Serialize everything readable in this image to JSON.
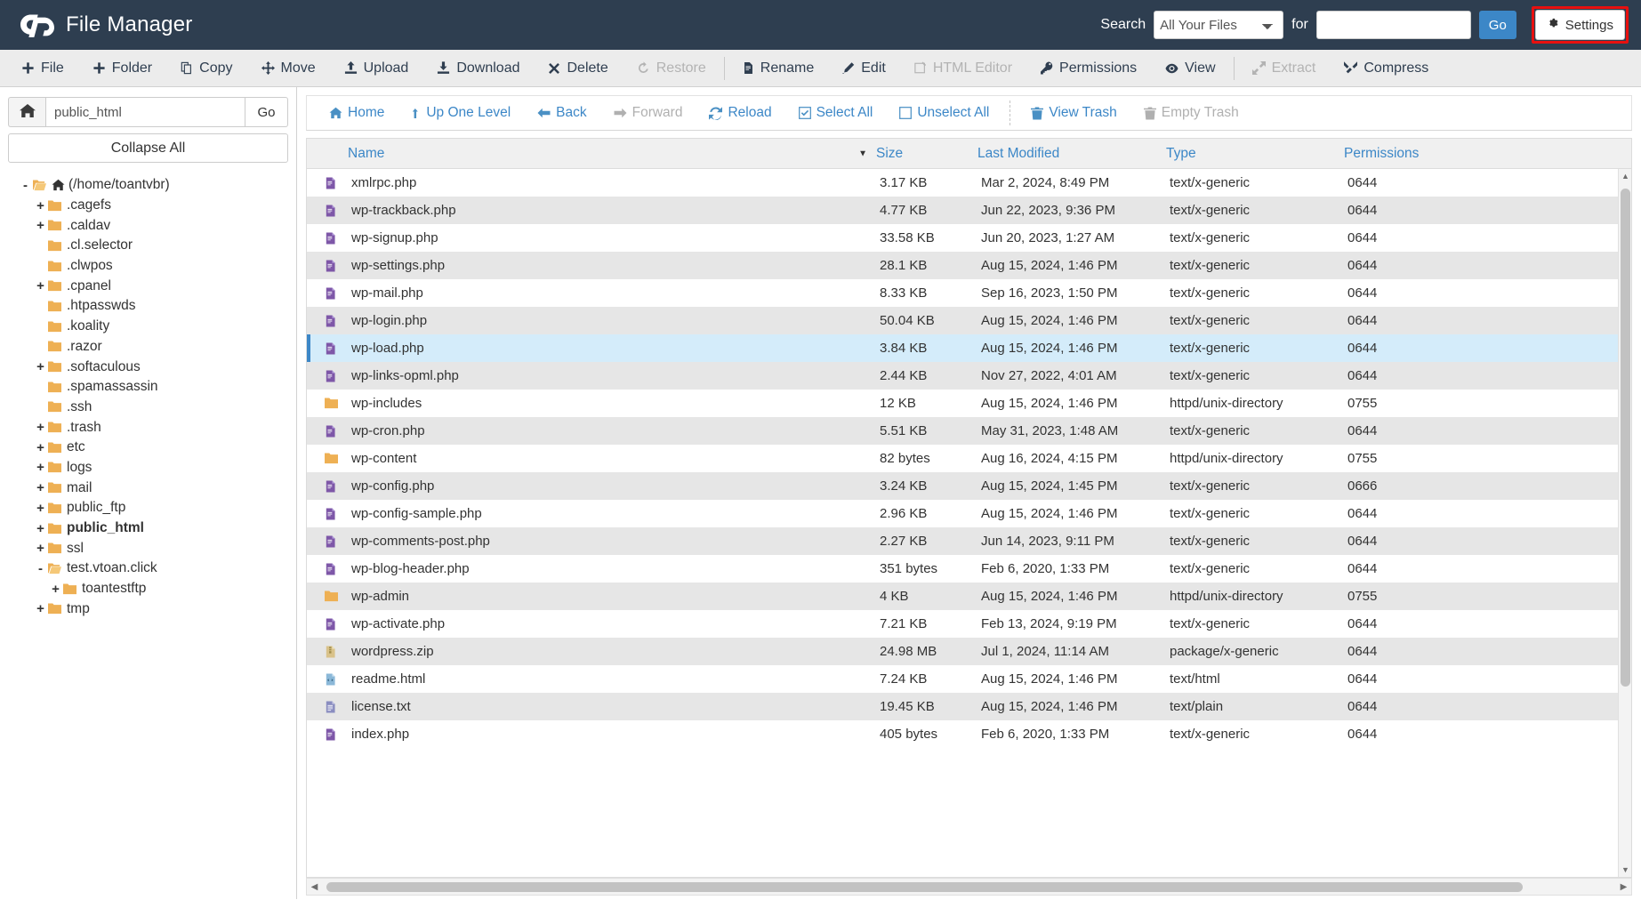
{
  "header": {
    "app_title": "File Manager",
    "logo_icon": "cpanel-logo-icon",
    "search_label": "Search",
    "search_scope_selected": "All Your Files",
    "search_scope_options": [
      "All Your Files"
    ],
    "for_label": "for",
    "search_value": "",
    "search_placeholder": "",
    "go_label": "Go",
    "settings_label": "Settings",
    "settings_icon": "gear-icon",
    "settings_highlight_color": "#e8100f",
    "bg_color": "#2e3e50"
  },
  "toolbar": {
    "items": [
      {
        "label": "File",
        "icon": "plus-icon",
        "disabled": false
      },
      {
        "label": "Folder",
        "icon": "plus-icon",
        "disabled": false
      },
      {
        "label": "Copy",
        "icon": "copy-icon",
        "disabled": false
      },
      {
        "label": "Move",
        "icon": "move-arrows-icon",
        "disabled": false
      },
      {
        "label": "Upload",
        "icon": "upload-icon",
        "disabled": false
      },
      {
        "label": "Download",
        "icon": "download-icon",
        "disabled": false
      },
      {
        "label": "Delete",
        "icon": "x-icon",
        "disabled": false
      },
      {
        "label": "Restore",
        "icon": "restore-icon",
        "disabled": true
      },
      {
        "separator": true
      },
      {
        "label": "Rename",
        "icon": "file-icon",
        "disabled": false
      },
      {
        "label": "Edit",
        "icon": "pencil-icon",
        "disabled": false
      },
      {
        "label": "HTML Editor",
        "icon": "html-editor-icon",
        "disabled": true
      },
      {
        "label": "Permissions",
        "icon": "key-icon",
        "disabled": false
      },
      {
        "label": "View",
        "icon": "eye-icon",
        "disabled": false
      },
      {
        "separator": true
      },
      {
        "label": "Extract",
        "icon": "extract-icon",
        "disabled": true
      },
      {
        "label": "Compress",
        "icon": "compress-icon",
        "disabled": false
      }
    ]
  },
  "sidebar": {
    "home_icon": "home-icon",
    "path_value": "public_html",
    "go_label": "Go",
    "collapse_all_label": "Collapse All",
    "tree": [
      {
        "toggle": "-",
        "label": "(/home/toantvbr)",
        "depth": 0,
        "open": true,
        "home": true,
        "bold": false
      },
      {
        "toggle": "+",
        "label": ".cagefs",
        "depth": 1,
        "open": false,
        "home": false,
        "bold": false
      },
      {
        "toggle": "+",
        "label": ".caldav",
        "depth": 1,
        "open": false,
        "home": false,
        "bold": false
      },
      {
        "toggle": "",
        "label": ".cl.selector",
        "depth": 1,
        "open": false,
        "home": false,
        "bold": false
      },
      {
        "toggle": "",
        "label": ".clwpos",
        "depth": 1,
        "open": false,
        "home": false,
        "bold": false
      },
      {
        "toggle": "+",
        "label": ".cpanel",
        "depth": 1,
        "open": false,
        "home": false,
        "bold": false
      },
      {
        "toggle": "",
        "label": ".htpasswds",
        "depth": 1,
        "open": false,
        "home": false,
        "bold": false
      },
      {
        "toggle": "",
        "label": ".koality",
        "depth": 1,
        "open": false,
        "home": false,
        "bold": false
      },
      {
        "toggle": "",
        "label": ".razor",
        "depth": 1,
        "open": false,
        "home": false,
        "bold": false
      },
      {
        "toggle": "+",
        "label": ".softaculous",
        "depth": 1,
        "open": false,
        "home": false,
        "bold": false
      },
      {
        "toggle": "",
        "label": ".spamassassin",
        "depth": 1,
        "open": false,
        "home": false,
        "bold": false
      },
      {
        "toggle": "",
        "label": ".ssh",
        "depth": 1,
        "open": false,
        "home": false,
        "bold": false
      },
      {
        "toggle": "+",
        "label": ".trash",
        "depth": 1,
        "open": false,
        "home": false,
        "bold": false
      },
      {
        "toggle": "+",
        "label": "etc",
        "depth": 1,
        "open": false,
        "home": false,
        "bold": false
      },
      {
        "toggle": "+",
        "label": "logs",
        "depth": 1,
        "open": false,
        "home": false,
        "bold": false
      },
      {
        "toggle": "+",
        "label": "mail",
        "depth": 1,
        "open": false,
        "home": false,
        "bold": false
      },
      {
        "toggle": "+",
        "label": "public_ftp",
        "depth": 1,
        "open": false,
        "home": false,
        "bold": false
      },
      {
        "toggle": "+",
        "label": "public_html",
        "depth": 1,
        "open": false,
        "home": false,
        "bold": true
      },
      {
        "toggle": "+",
        "label": "ssl",
        "depth": 1,
        "open": false,
        "home": false,
        "bold": false
      },
      {
        "toggle": "-",
        "label": "test.vtoan.click",
        "depth": 1,
        "open": true,
        "home": false,
        "bold": false
      },
      {
        "toggle": "+",
        "label": "toantestftp",
        "depth": 2,
        "open": false,
        "home": false,
        "bold": false
      },
      {
        "toggle": "+",
        "label": "tmp",
        "depth": 1,
        "open": false,
        "home": false,
        "bold": false
      }
    ]
  },
  "navbar": {
    "items": [
      {
        "label": "Home",
        "icon": "home-icon",
        "disabled": false
      },
      {
        "label": "Up One Level",
        "icon": "up-arrow-icon",
        "disabled": false
      },
      {
        "label": "Back",
        "icon": "left-arrow-icon",
        "disabled": false
      },
      {
        "label": "Forward",
        "icon": "right-arrow-icon",
        "disabled": true
      },
      {
        "label": "Reload",
        "icon": "reload-icon",
        "disabled": false
      },
      {
        "label": "Select All",
        "icon": "checked-box-icon",
        "disabled": false
      },
      {
        "label": "Unselect All",
        "icon": "empty-box-icon",
        "disabled": false
      },
      {
        "separator": true
      },
      {
        "label": "View Trash",
        "icon": "trash-icon",
        "disabled": false
      },
      {
        "label": "Empty Trash",
        "icon": "trash-icon",
        "disabled": true
      }
    ]
  },
  "file_table": {
    "columns": [
      "Name",
      "Size",
      "Last Modified",
      "Type",
      "Permissions"
    ],
    "sort_column": "Name",
    "sort_direction": "desc",
    "sort_caret": "▼",
    "rows": [
      {
        "name": "xmlrpc.php",
        "icon": "php-file-icon",
        "size": "3.17 KB",
        "modified": "Mar 2, 2024, 8:49 PM",
        "type": "text/x-generic",
        "permissions": "0644",
        "selected": false
      },
      {
        "name": "wp-trackback.php",
        "icon": "php-file-icon",
        "size": "4.77 KB",
        "modified": "Jun 22, 2023, 9:36 PM",
        "type": "text/x-generic",
        "permissions": "0644",
        "selected": false
      },
      {
        "name": "wp-signup.php",
        "icon": "php-file-icon",
        "size": "33.58 KB",
        "modified": "Jun 20, 2023, 1:27 AM",
        "type": "text/x-generic",
        "permissions": "0644",
        "selected": false
      },
      {
        "name": "wp-settings.php",
        "icon": "php-file-icon",
        "size": "28.1 KB",
        "modified": "Aug 15, 2024, 1:46 PM",
        "type": "text/x-generic",
        "permissions": "0644",
        "selected": false
      },
      {
        "name": "wp-mail.php",
        "icon": "php-file-icon",
        "size": "8.33 KB",
        "modified": "Sep 16, 2023, 1:50 PM",
        "type": "text/x-generic",
        "permissions": "0644",
        "selected": false
      },
      {
        "name": "wp-login.php",
        "icon": "php-file-icon",
        "size": "50.04 KB",
        "modified": "Aug 15, 2024, 1:46 PM",
        "type": "text/x-generic",
        "permissions": "0644",
        "selected": false
      },
      {
        "name": "wp-load.php",
        "icon": "php-file-icon",
        "size": "3.84 KB",
        "modified": "Aug 15, 2024, 1:46 PM",
        "type": "text/x-generic",
        "permissions": "0644",
        "selected": true
      },
      {
        "name": "wp-links-opml.php",
        "icon": "php-file-icon",
        "size": "2.44 KB",
        "modified": "Nov 27, 2022, 4:01 AM",
        "type": "text/x-generic",
        "permissions": "0644",
        "selected": false
      },
      {
        "name": "wp-includes",
        "icon": "folder-icon",
        "size": "12 KB",
        "modified": "Aug 15, 2024, 1:46 PM",
        "type": "httpd/unix-directory",
        "permissions": "0755",
        "selected": false
      },
      {
        "name": "wp-cron.php",
        "icon": "php-file-icon",
        "size": "5.51 KB",
        "modified": "May 31, 2023, 1:48 AM",
        "type": "text/x-generic",
        "permissions": "0644",
        "selected": false
      },
      {
        "name": "wp-content",
        "icon": "folder-icon",
        "size": "82 bytes",
        "modified": "Aug 16, 2024, 4:15 PM",
        "type": "httpd/unix-directory",
        "permissions": "0755",
        "selected": false
      },
      {
        "name": "wp-config.php",
        "icon": "php-file-icon",
        "size": "3.24 KB",
        "modified": "Aug 15, 2024, 1:45 PM",
        "type": "text/x-generic",
        "permissions": "0666",
        "selected": false
      },
      {
        "name": "wp-config-sample.php",
        "icon": "php-file-icon",
        "size": "2.96 KB",
        "modified": "Aug 15, 2024, 1:46 PM",
        "type": "text/x-generic",
        "permissions": "0644",
        "selected": false
      },
      {
        "name": "wp-comments-post.php",
        "icon": "php-file-icon",
        "size": "2.27 KB",
        "modified": "Jun 14, 2023, 9:11 PM",
        "type": "text/x-generic",
        "permissions": "0644",
        "selected": false
      },
      {
        "name": "wp-blog-header.php",
        "icon": "php-file-icon",
        "size": "351 bytes",
        "modified": "Feb 6, 2020, 1:33 PM",
        "type": "text/x-generic",
        "permissions": "0644",
        "selected": false
      },
      {
        "name": "wp-admin",
        "icon": "folder-icon",
        "size": "4 KB",
        "modified": "Aug 15, 2024, 1:46 PM",
        "type": "httpd/unix-directory",
        "permissions": "0755",
        "selected": false
      },
      {
        "name": "wp-activate.php",
        "icon": "php-file-icon",
        "size": "7.21 KB",
        "modified": "Feb 13, 2024, 9:19 PM",
        "type": "text/x-generic",
        "permissions": "0644",
        "selected": false
      },
      {
        "name": "wordpress.zip",
        "icon": "archive-file-icon",
        "size": "24.98 MB",
        "modified": "Jul 1, 2024, 11:14 AM",
        "type": "package/x-generic",
        "permissions": "0644",
        "selected": false
      },
      {
        "name": "readme.html",
        "icon": "html-file-icon",
        "size": "7.24 KB",
        "modified": "Aug 15, 2024, 1:46 PM",
        "type": "text/html",
        "permissions": "0644",
        "selected": false
      },
      {
        "name": "license.txt",
        "icon": "text-file-icon",
        "size": "19.45 KB",
        "modified": "Aug 15, 2024, 1:46 PM",
        "type": "text/plain",
        "permissions": "0644",
        "selected": false
      },
      {
        "name": "index.php",
        "icon": "php-file-icon",
        "size": "405 bytes",
        "modified": "Feb 6, 2020, 1:33 PM",
        "type": "text/x-generic",
        "permissions": "0644",
        "selected": false
      }
    ]
  },
  "scrollbars": {
    "vertical_up": "▲",
    "vertical_down": "▼",
    "horizontal_left": "◀",
    "horizontal_right": "▶"
  }
}
